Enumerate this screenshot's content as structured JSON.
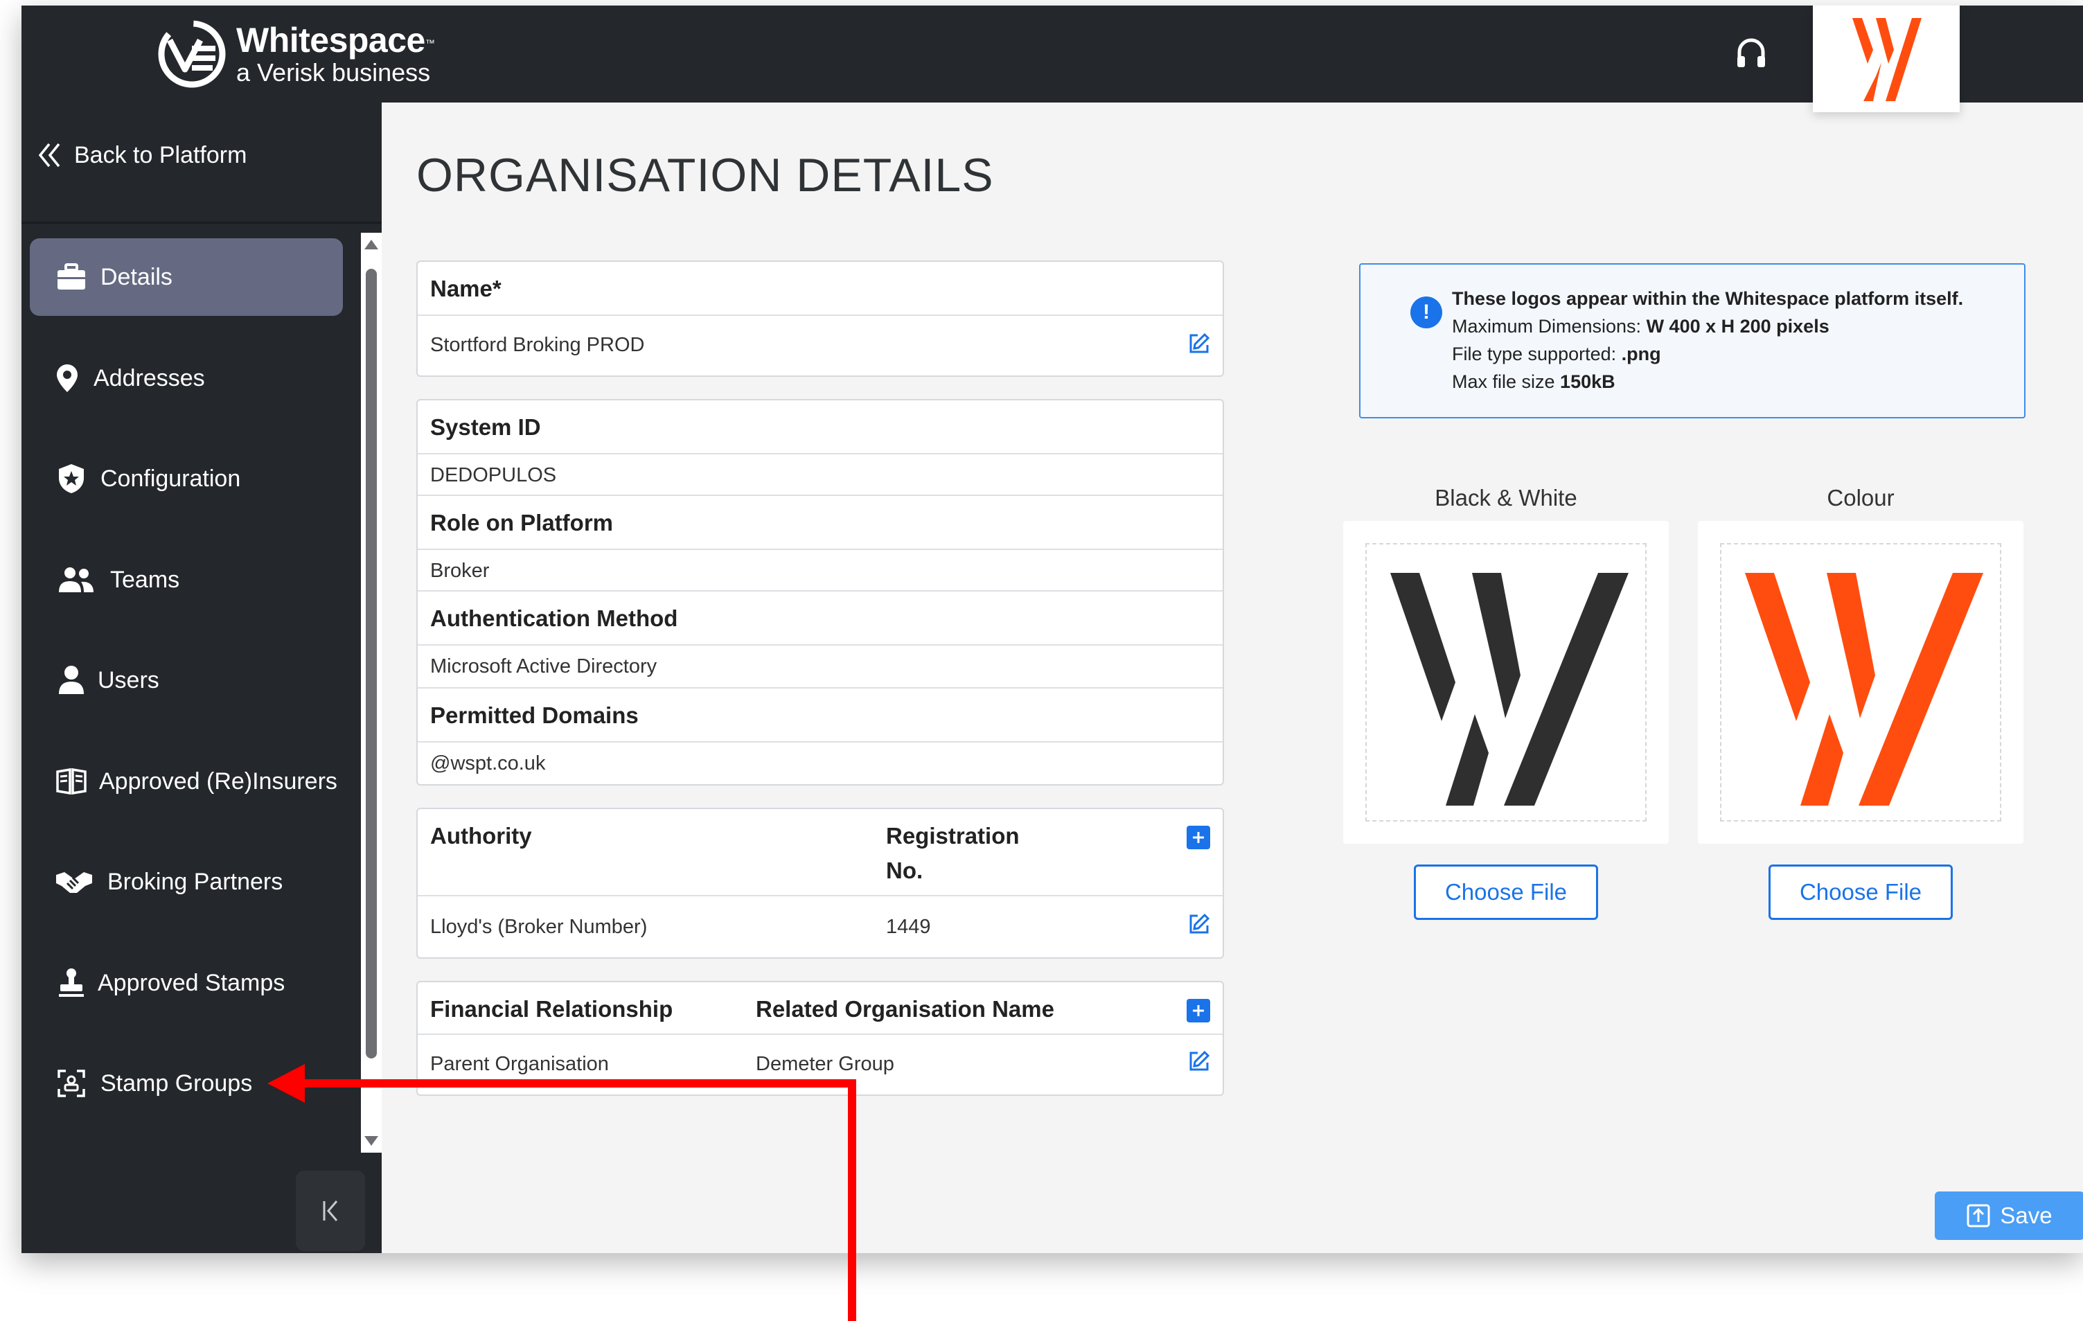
{
  "header": {
    "brand_name": "Whitespace",
    "brand_trademark": "™",
    "brand_sub": "a Verisk business",
    "support_icon": "headset-icon",
    "org_logo_color": "#ff4d0f"
  },
  "sidebar": {
    "back_label": "Back to Platform",
    "items": [
      {
        "label": "Details",
        "icon": "briefcase-icon",
        "active": true
      },
      {
        "label": "Addresses",
        "icon": "map-pin-icon"
      },
      {
        "label": "Configuration",
        "icon": "shield-star-icon"
      },
      {
        "label": "Teams",
        "icon": "users-icon"
      },
      {
        "label": "Users",
        "icon": "user-icon"
      },
      {
        "label": "Approved (Re)Insurers",
        "icon": "book-icon"
      },
      {
        "label": "Broking Partners",
        "icon": "handshake-icon"
      },
      {
        "label": "Approved Stamps",
        "icon": "stamp-icon"
      },
      {
        "label": "Stamp Groups",
        "icon": "scan-group-icon"
      }
    ],
    "collapse_icon": "collapse-left-icon"
  },
  "main": {
    "title": "ORGANISATION DETAILS",
    "name_card": {
      "label": "Name*",
      "value": "Stortford Broking PROD"
    },
    "details_card": [
      {
        "label": "System ID",
        "value": "DEDOPULOS"
      },
      {
        "label": "Role on Platform",
        "value": "Broker"
      },
      {
        "label": "Authentication Method",
        "value": "Microsoft Active Directory"
      },
      {
        "label": "Permitted Domains",
        "value": "@wspt.co.uk"
      }
    ],
    "authority_card": {
      "col1": "Authority",
      "col2_line1": "Registration",
      "col2_line2": "No.",
      "rows": [
        {
          "authority": "Lloyd's (Broker Number)",
          "number": "1449"
        }
      ]
    },
    "financial_card": {
      "col1": "Financial Relationship",
      "col2": "Related Organisation Name",
      "rows": [
        {
          "relationship": "Parent Organisation",
          "org": "Demeter Group"
        }
      ]
    },
    "info": {
      "line1": "These logos appear within the Whitespace platform itself.",
      "line2_prefix": "Maximum Dimensions: ",
      "line2_bold": "W 400 x H 200 pixels",
      "line3_prefix": "File type supported: ",
      "line3_bold": ".png",
      "line4_prefix": "Max file size ",
      "line4_bold": "150kB"
    },
    "logos": {
      "bw_label": "Black & White",
      "colour_label": "Colour",
      "choose_label": "Choose File",
      "bw_color": "#2f2f2f",
      "colour_color": "#ff4d0f"
    },
    "save_label": "Save"
  },
  "colors": {
    "sidebar_bg": "#24272b",
    "active_item": "#656a82",
    "accent": "#1a73e8",
    "annotation": "#ff0000"
  }
}
